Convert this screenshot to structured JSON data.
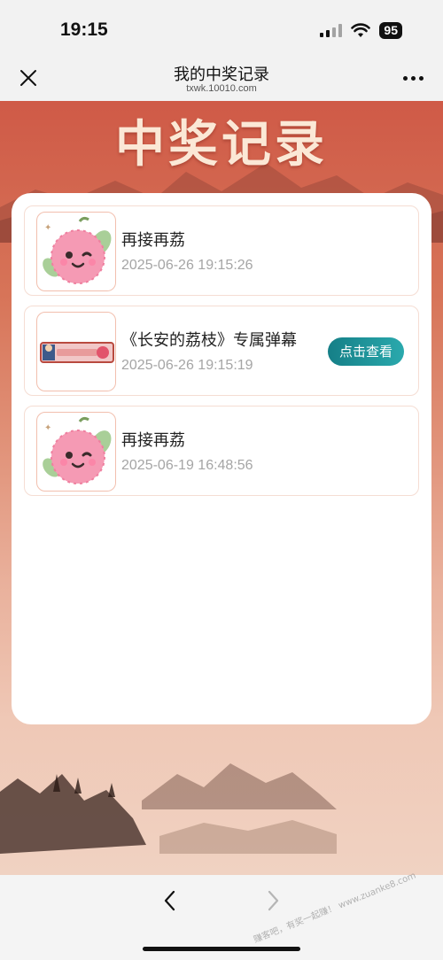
{
  "status_bar": {
    "time": "19:15",
    "battery": "95",
    "icons": [
      "signal-icon",
      "wifi-icon",
      "battery-icon"
    ]
  },
  "nav": {
    "title": "我的中奖记录",
    "subtitle": "txwk.10010.com",
    "close_icon": "close-icon",
    "more_icon": "more-icon"
  },
  "hero": {
    "title": "中奖记录"
  },
  "records": [
    {
      "title": "再接再荔",
      "time": "2025-06-26 19:15:26",
      "thumb": "lychee-mascot"
    },
    {
      "title": "《长安的荔枝》专属弹幕",
      "time": "2025-06-26 19:15:19",
      "thumb": "danmaku-banner",
      "button": "点击查看"
    },
    {
      "title": "再接再荔",
      "time": "2025-06-19 16:48:56",
      "thumb": "lychee-mascot"
    }
  ],
  "toolbar": {
    "back_icon": "back-arrow-icon",
    "forward_icon": "forward-arrow-icon"
  },
  "watermark": "赚客吧，有奖一起赚！ www.zuanke8.com",
  "colors": {
    "accent": "#1f949a",
    "background_top": "#cf5a47",
    "card": "#ffffff",
    "time_text": "#a5a5a5"
  }
}
